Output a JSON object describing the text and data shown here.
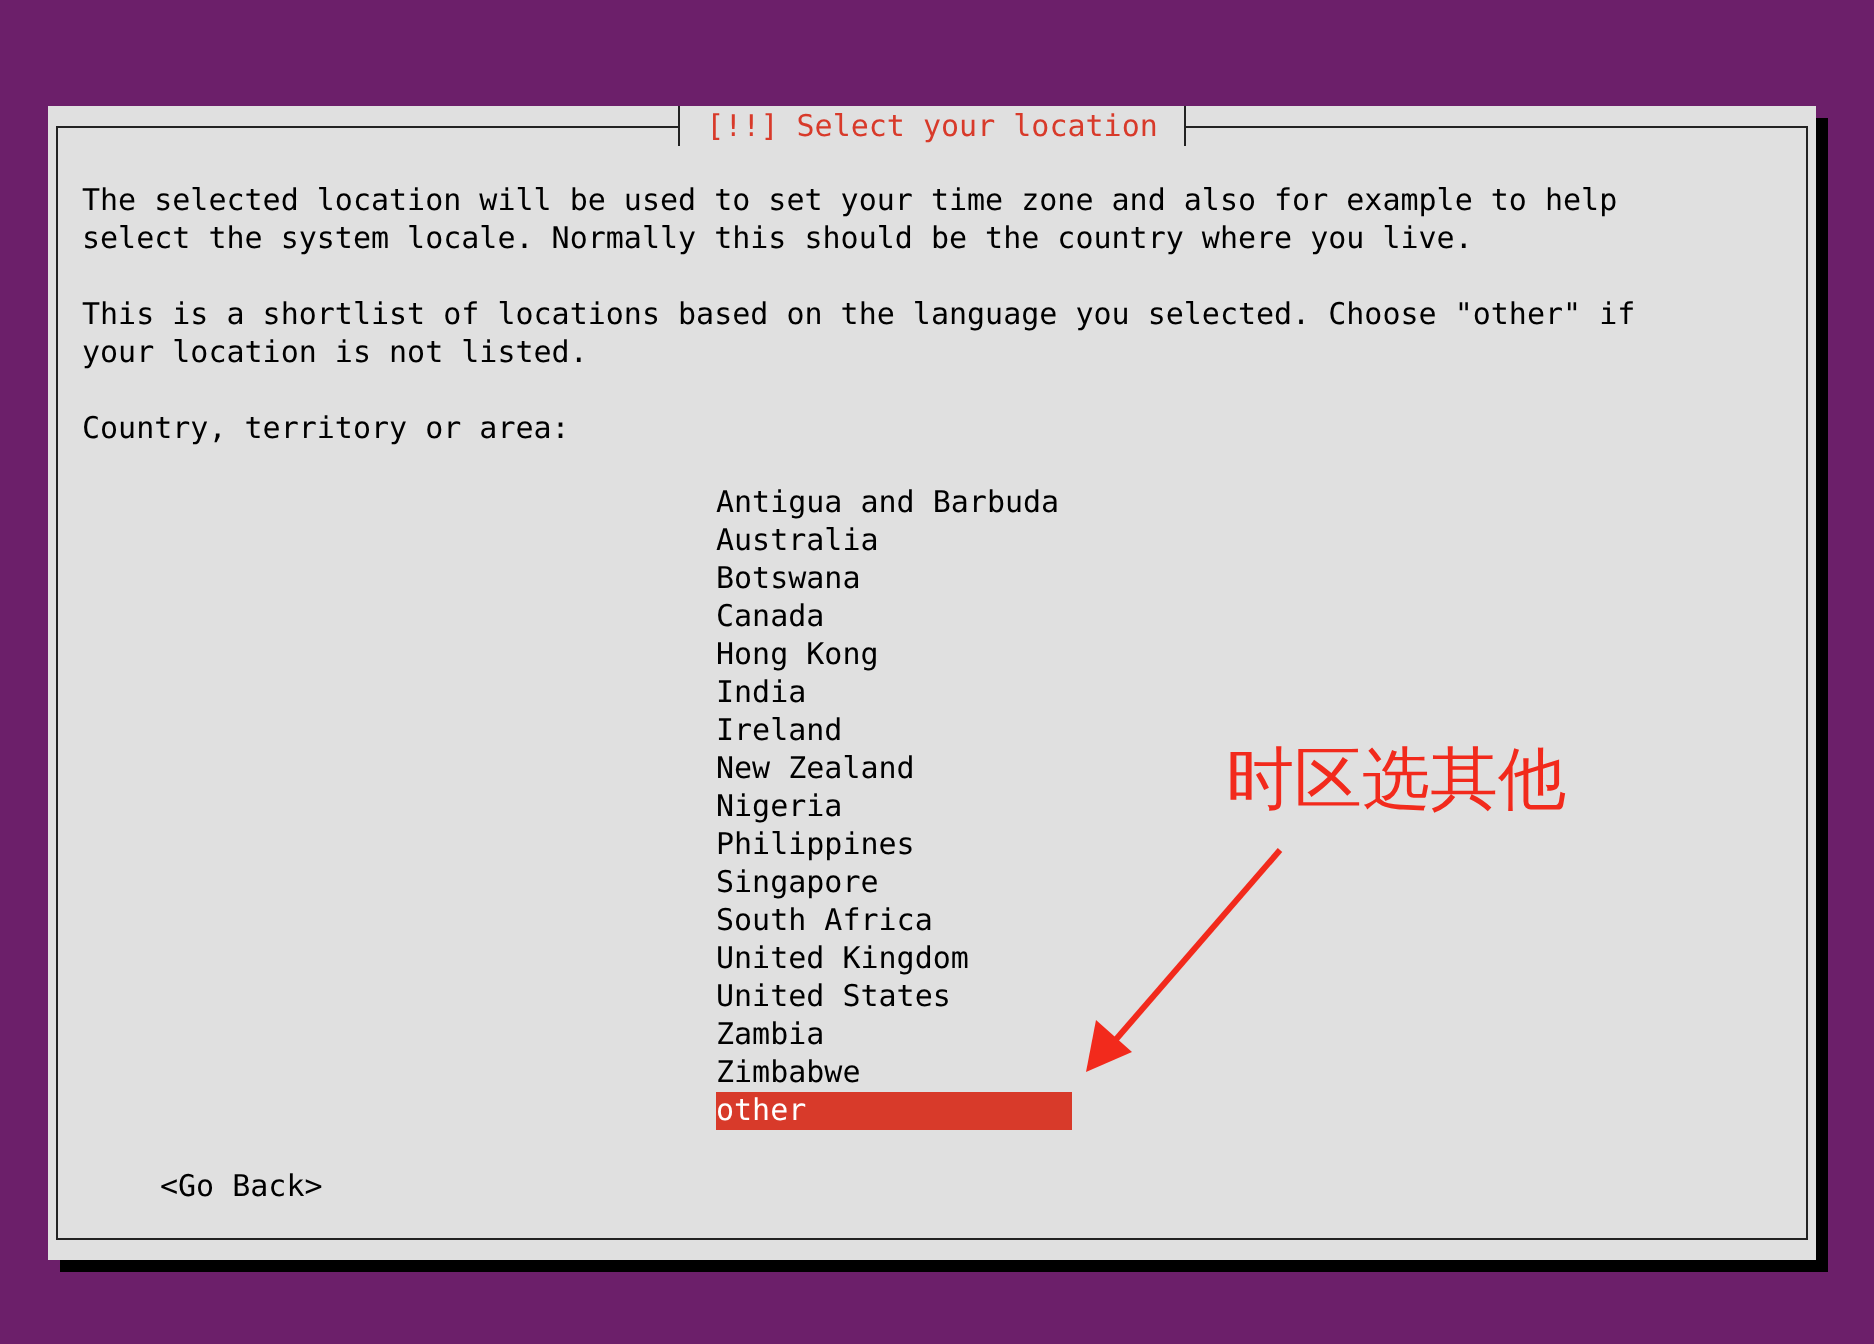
{
  "dialog": {
    "title": "[!!] Select your location",
    "paragraphs": [
      "The selected location will be used to set your time zone and also for example to help select the system locale. Normally this should be the country where you live.",
      "This is a shortlist of locations based on the language you selected. Choose \"other\" if your location is not listed."
    ],
    "list_label": "Country, territory or area:",
    "countries": [
      {
        "label": "Antigua and Barbuda",
        "selected": false
      },
      {
        "label": "Australia",
        "selected": false
      },
      {
        "label": "Botswana",
        "selected": false
      },
      {
        "label": "Canada",
        "selected": false
      },
      {
        "label": "Hong Kong",
        "selected": false
      },
      {
        "label": "India",
        "selected": false
      },
      {
        "label": "Ireland",
        "selected": false
      },
      {
        "label": "New Zealand",
        "selected": false
      },
      {
        "label": "Nigeria",
        "selected": false
      },
      {
        "label": "Philippines",
        "selected": false
      },
      {
        "label": "Singapore",
        "selected": false
      },
      {
        "label": "South Africa",
        "selected": false
      },
      {
        "label": "United Kingdom",
        "selected": false
      },
      {
        "label": "United States",
        "selected": false
      },
      {
        "label": "Zambia",
        "selected": false
      },
      {
        "label": "Zimbabwe",
        "selected": false
      },
      {
        "label": "other",
        "selected": true
      }
    ],
    "go_back": "<Go Back>"
  },
  "annotation": {
    "text": "时区选其他"
  }
}
